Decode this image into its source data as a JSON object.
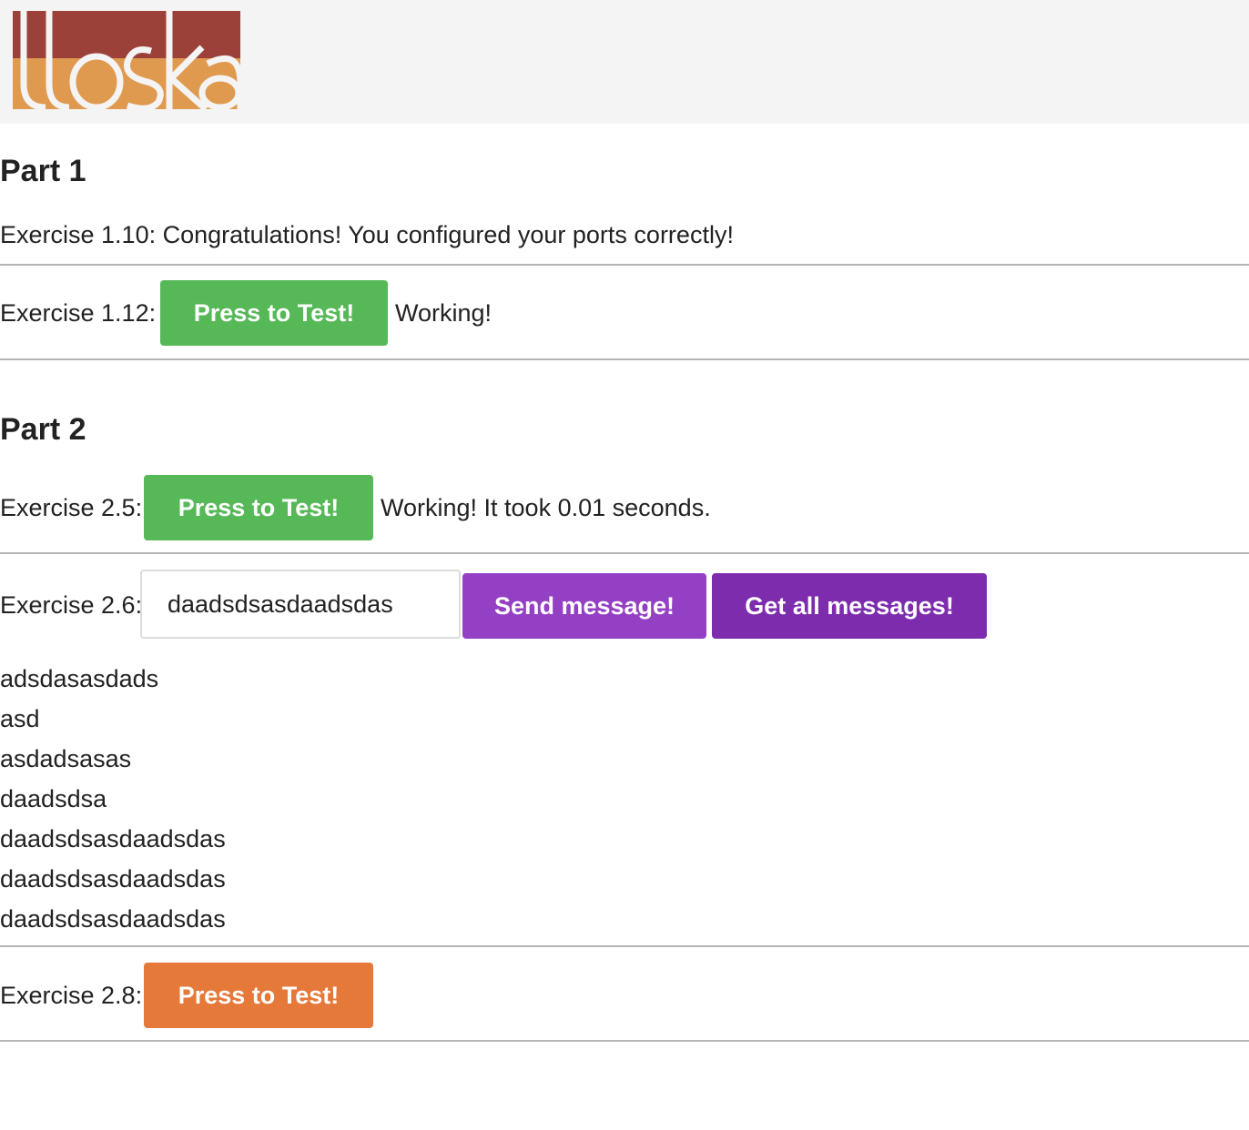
{
  "header": {
    "logo_text": "itoska",
    "logo_colors": {
      "top": "#9c4139",
      "bottom": "#e09a4f"
    }
  },
  "part1": {
    "heading": "Part 1",
    "ex110": "Exercise 1.10: Congratulations! You configured your ports correctly!",
    "ex112": {
      "label": "Exercise 1.12:",
      "button": "Press to Test!",
      "status": "Working!"
    }
  },
  "part2": {
    "heading": "Part 2",
    "ex25": {
      "label": "Exercise 2.5:",
      "button": "Press to Test!",
      "status": "Working! It took 0.01 seconds."
    },
    "ex26": {
      "label": "Exercise 2.6:",
      "input_value": "daadsdsasdaadsdas",
      "send_button": "Send message!",
      "get_button": "Get all messages!",
      "messages": [
        "adsdasasdads",
        "asd",
        "asdadsasas",
        "daadsdsa",
        "daadsdsasdaadsdas",
        "daadsdsasdaadsdas",
        "daadsdsasdaadsdas"
      ]
    },
    "ex28": {
      "label": "Exercise 2.8:",
      "button": "Press to Test!"
    }
  },
  "colors": {
    "green": "#56b857",
    "purple": "#9440c4",
    "purple_dark": "#7d2cae",
    "orange": "#e5793a"
  }
}
